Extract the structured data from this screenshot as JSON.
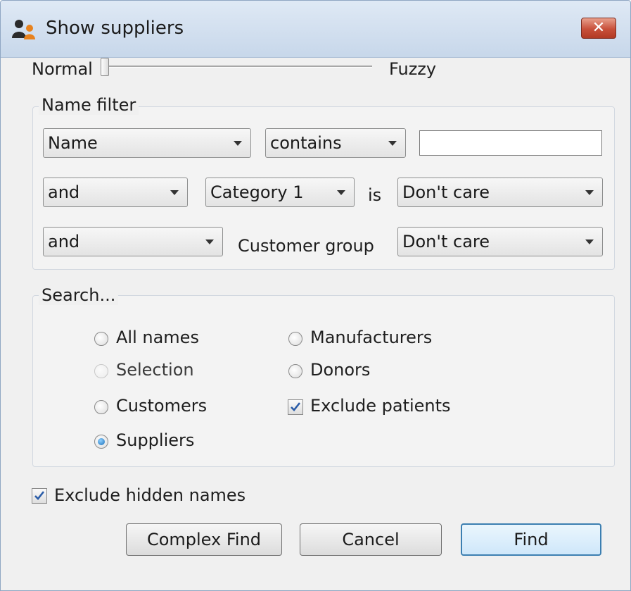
{
  "window": {
    "title": "Show suppliers",
    "close_symbol": "✕"
  },
  "slider": {
    "left_label": "Normal",
    "right_label": "Fuzzy",
    "position": 0
  },
  "name_filter": {
    "legend": "Name filter",
    "row1": {
      "field": "Name",
      "operator": "contains",
      "text_value": ""
    },
    "row2": {
      "conjunction": "and",
      "field": "Category 1",
      "is_label": "is",
      "value": "Don't care"
    },
    "row3": {
      "conjunction": "and",
      "field_label": "Customer group",
      "value": "Don't care"
    }
  },
  "search": {
    "legend": "Search...",
    "options": {
      "all_names": "All names",
      "selection": "Selection",
      "customers": "Customers",
      "suppliers": "Suppliers",
      "manufacturers": "Manufacturers",
      "donors": "Donors"
    },
    "selected": "suppliers",
    "exclude_patients_label": "Exclude patients",
    "exclude_patients_checked": true
  },
  "exclude_hidden": {
    "label": "Exclude hidden names",
    "checked": true
  },
  "buttons": {
    "complex_find": "Complex Find",
    "cancel": "Cancel",
    "find": "Find"
  },
  "colors": {
    "close_button": "#c8503a",
    "accent": "#3c7fb1",
    "check_mark": "#2a5ca8"
  }
}
